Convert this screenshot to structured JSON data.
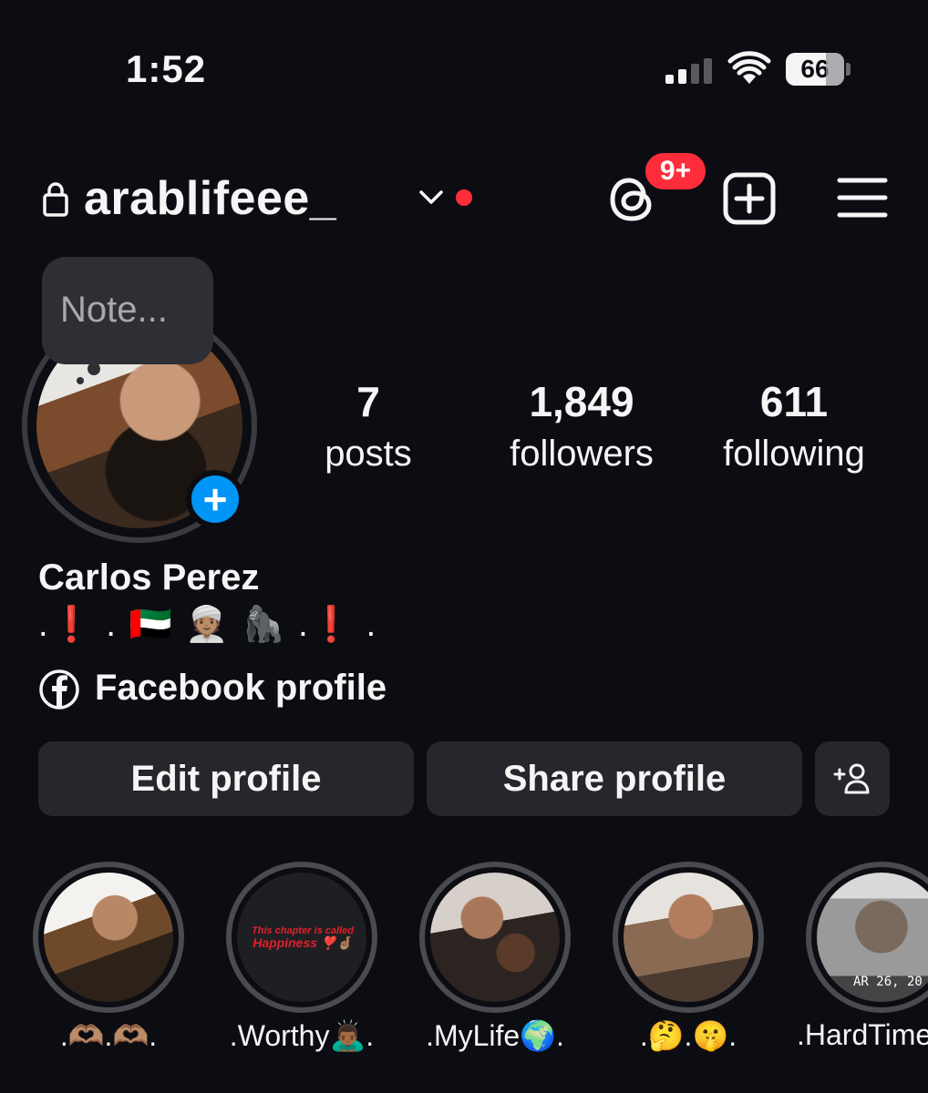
{
  "status_bar": {
    "time": "1:52",
    "battery": "66"
  },
  "header": {
    "username": "arablifeee_",
    "threads_badge": "9+",
    "accent_red": "#ff2d3b"
  },
  "note": {
    "placeholder": "Note..."
  },
  "stats": {
    "posts": {
      "value": "7",
      "label": "posts"
    },
    "followers": {
      "value": "1,849",
      "label": "followers"
    },
    "following": {
      "value": "611",
      "label": "following"
    }
  },
  "profile": {
    "full_name": "Carlos Perez",
    "bio": ".❗ . 🇦🇪 👳🏽 🦍 .❗ .",
    "facebook_link": "Facebook profile"
  },
  "buttons": {
    "edit": "Edit profile",
    "share": "Share profile",
    "add_user_icon": "add-person-icon"
  },
  "highlights": [
    {
      "label": ".🫶🏽.🫶🏽."
    },
    {
      "label": ".Worthy🙇🏾‍♂️.",
      "cover_text_1": "This chapter is called",
      "cover_text_2": "Happiness ❣️🤞🏽"
    },
    {
      "label": ".MyLife🌍."
    },
    {
      "label": ".🤔.🤫."
    },
    {
      "label": ".HardTime",
      "cover_text": "AR 26, 20"
    }
  ],
  "colors": {
    "background": "#0c0d12",
    "button_bg": "#25272c",
    "accent_blue": "#0095f6"
  }
}
